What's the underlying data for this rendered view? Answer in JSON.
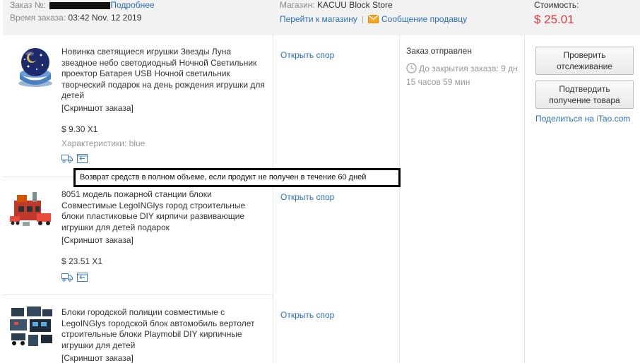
{
  "header": {
    "order_label": "Заказ №:",
    "details_link": "Подробнее",
    "order_time_label": "Время заказа:",
    "order_time": "03:42 Nov. 12 2019",
    "store_label": "Магазин:",
    "store_name": "KACUU Block Store",
    "go_to_store": "Перейти к магазину",
    "separator": "|",
    "message_seller": "Сообщение продавцу",
    "cost_label": "Стоимость:",
    "cost": "$ 25.01"
  },
  "products": [
    {
      "title": "Новинка светящиеся игрушки Звезды Луна звездное небо светодиодный Ночной Светильник проектор Батарея USB Ночной светильник творческий подарок на день рождения игрушки для детей",
      "snapshot": "[Скриншот заказа]",
      "price": "$ 9.30 X1",
      "attributes": "Характеристики: blue",
      "dispute": "Открыть спор"
    },
    {
      "title": "8051 модель пожарной станции блоки Совместимые LegoINGlys город строительные блоки пластиковые DIY кирпичи развивающие игрушки для детей подарок",
      "snapshot": "[Скриншот заказа]",
      "price": "$ 23.51 X1",
      "dispute": "Открыть спор"
    },
    {
      "title": "Блоки городской полиции совместимые с LegoINGlys городской блок автомобиль вертолет строительные блоки Playmobil DIY кирпичные игрушки для детей",
      "snapshot": "[Скриншот заказа]",
      "dispute": "Открыть спор"
    }
  ],
  "status": {
    "text": "Заказ отправлен",
    "countdown": "До закрытия заказа: 9 дн 15 часов 59 мин"
  },
  "actions": {
    "track": "Проверить отслеживание",
    "confirm": "Подтвердить получение товара",
    "share_prefix": "Поделиться на ",
    "share_i": "i",
    "share_rest": "Tao.com"
  },
  "tooltip": "Возврат средств в полном объеме, если продукт не получен в течение 60 дней",
  "colors": {
    "link": "#2b6fba",
    "price": "#e4393c",
    "header_bg": "#f2f2f2"
  }
}
